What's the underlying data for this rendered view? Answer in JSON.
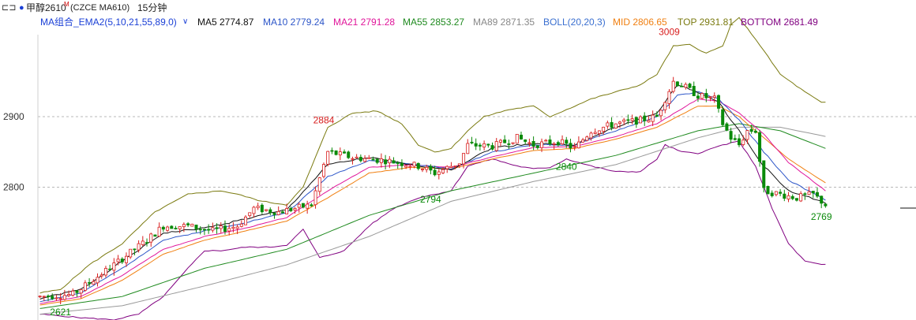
{
  "header": {
    "panel_icon": "panel-toggle-icon",
    "dot_color": "#1a3fd6",
    "instrument": "甲醇2610",
    "instrument_sup": "M",
    "symbol": "(CZCE MA610)",
    "period": "15分钟"
  },
  "indicators": {
    "group_label": "MA组合_EMA2(5,10,21,55,89,0)",
    "ma5": "MA5 2774.87",
    "ma10": "MA10 2779.24",
    "ma21": "MA21 2791.28",
    "ma55": "MA55 2853.27",
    "ma89": "MA89 2871.35",
    "boll": "BOLL(20,20,3)",
    "mid": "MID 2806.65",
    "top": "TOP 2931.81",
    "bottom": "BOTTOM 2681.49"
  },
  "colors": {
    "up": "#d81e1e",
    "down": "#0a8a0a",
    "ma5": "#111111",
    "ma10": "#2c55c8",
    "ma21": "#e0159a",
    "ma55": "#1f8a1f",
    "ma89": "#999999",
    "boll": "#3a6fd0",
    "mid": "#f07f10",
    "top": "#7a7a10",
    "bottom": "#800080"
  },
  "chart_data": {
    "type": "candlestick",
    "y_ticks": [
      "2900",
      "2800"
    ],
    "ylim": [
      2615,
      3035
    ],
    "bars": 192,
    "annotations": [
      {
        "text": "2884",
        "value": 2884,
        "bar": 69,
        "kind": "high"
      },
      {
        "text": "2794",
        "value": 2794,
        "bar": 95,
        "kind": "low"
      },
      {
        "text": "2840",
        "value": 2840,
        "bar": 128,
        "kind": "low"
      },
      {
        "text": "3009",
        "value": 3009,
        "bar": 153,
        "kind": "high"
      },
      {
        "text": "2769",
        "value": 2769,
        "bar": 190,
        "kind": "low"
      },
      {
        "text": "2621",
        "value": 2621,
        "bar": 5,
        "kind": "low"
      }
    ],
    "close_path": [
      [
        0,
        2645
      ],
      [
        8,
        2648
      ],
      [
        18,
        2690
      ],
      [
        26,
        2725
      ],
      [
        30,
        2745
      ],
      [
        36,
        2745
      ],
      [
        42,
        2738
      ],
      [
        48,
        2745
      ],
      [
        52,
        2770
      ],
      [
        58,
        2765
      ],
      [
        62,
        2770
      ],
      [
        66,
        2775
      ],
      [
        70,
        2850
      ],
      [
        76,
        2842
      ],
      [
        84,
        2838
      ],
      [
        92,
        2830
      ],
      [
        96,
        2820
      ],
      [
        102,
        2835
      ],
      [
        104,
        2860
      ],
      [
        110,
        2858
      ],
      [
        116,
        2870
      ],
      [
        120,
        2860
      ],
      [
        126,
        2865
      ],
      [
        130,
        2855
      ],
      [
        134,
        2880
      ],
      [
        140,
        2890
      ],
      [
        146,
        2895
      ],
      [
        150,
        2900
      ],
      [
        154,
        2950
      ],
      [
        156,
        2945
      ],
      [
        160,
        2930
      ],
      [
        164,
        2925
      ],
      [
        166,
        2890
      ],
      [
        168,
        2870
      ],
      [
        170,
        2860
      ],
      [
        172,
        2880
      ],
      [
        174,
        2880
      ],
      [
        176,
        2795
      ],
      [
        180,
        2790
      ],
      [
        184,
        2785
      ],
      [
        188,
        2790
      ],
      [
        191,
        2775
      ]
    ],
    "ma5_path": [
      [
        0,
        2642
      ],
      [
        10,
        2655
      ],
      [
        20,
        2695
      ],
      [
        30,
        2735
      ],
      [
        40,
        2742
      ],
      [
        50,
        2755
      ],
      [
        60,
        2768
      ],
      [
        70,
        2832
      ],
      [
        80,
        2842
      ],
      [
        90,
        2832
      ],
      [
        100,
        2825
      ],
      [
        110,
        2856
      ],
      [
        120,
        2862
      ],
      [
        130,
        2860
      ],
      [
        140,
        2885
      ],
      [
        150,
        2905
      ],
      [
        155,
        2945
      ],
      [
        160,
        2935
      ],
      [
        165,
        2920
      ],
      [
        170,
        2880
      ],
      [
        176,
        2830
      ],
      [
        182,
        2795
      ],
      [
        191,
        2778
      ]
    ],
    "ma10_path": [
      [
        0,
        2638
      ],
      [
        10,
        2650
      ],
      [
        20,
        2685
      ],
      [
        30,
        2725
      ],
      [
        40,
        2738
      ],
      [
        50,
        2750
      ],
      [
        60,
        2764
      ],
      [
        70,
        2815
      ],
      [
        80,
        2838
      ],
      [
        90,
        2833
      ],
      [
        100,
        2826
      ],
      [
        110,
        2850
      ],
      [
        120,
        2860
      ],
      [
        130,
        2860
      ],
      [
        140,
        2880
      ],
      [
        150,
        2900
      ],
      [
        155,
        2930
      ],
      [
        160,
        2935
      ],
      [
        165,
        2925
      ],
      [
        170,
        2895
      ],
      [
        176,
        2850
      ],
      [
        182,
        2810
      ],
      [
        191,
        2782
      ]
    ],
    "ma21_path": [
      [
        0,
        2635
      ],
      [
        10,
        2645
      ],
      [
        20,
        2675
      ],
      [
        30,
        2712
      ],
      [
        40,
        2730
      ],
      [
        50,
        2742
      ],
      [
        60,
        2757
      ],
      [
        70,
        2795
      ],
      [
        80,
        2828
      ],
      [
        90,
        2832
      ],
      [
        100,
        2828
      ],
      [
        110,
        2843
      ],
      [
        120,
        2856
      ],
      [
        130,
        2858
      ],
      [
        140,
        2872
      ],
      [
        150,
        2890
      ],
      [
        160,
        2925
      ],
      [
        165,
        2922
      ],
      [
        170,
        2905
      ],
      [
        176,
        2875
      ],
      [
        182,
        2835
      ],
      [
        191,
        2795
      ]
    ],
    "mid_path": [
      [
        0,
        2633
      ],
      [
        10,
        2642
      ],
      [
        20,
        2668
      ],
      [
        30,
        2705
      ],
      [
        40,
        2725
      ],
      [
        50,
        2738
      ],
      [
        60,
        2752
      ],
      [
        70,
        2785
      ],
      [
        80,
        2820
      ],
      [
        90,
        2828
      ],
      [
        100,
        2826
      ],
      [
        110,
        2840
      ],
      [
        120,
        2852
      ],
      [
        130,
        2855
      ],
      [
        140,
        2868
      ],
      [
        150,
        2885
      ],
      [
        160,
        2915
      ],
      [
        165,
        2915
      ],
      [
        170,
        2900
      ],
      [
        176,
        2870
      ],
      [
        182,
        2840
      ],
      [
        191,
        2806
      ]
    ],
    "ma55_path": [
      [
        0,
        2628
      ],
      [
        20,
        2645
      ],
      [
        40,
        2685
      ],
      [
        60,
        2712
      ],
      [
        80,
        2760
      ],
      [
        100,
        2795
      ],
      [
        120,
        2820
      ],
      [
        140,
        2845
      ],
      [
        160,
        2880
      ],
      [
        170,
        2890
      ],
      [
        180,
        2880
      ],
      [
        191,
        2855
      ]
    ],
    "ma89_path": [
      [
        0,
        2620
      ],
      [
        20,
        2632
      ],
      [
        40,
        2660
      ],
      [
        60,
        2690
      ],
      [
        80,
        2730
      ],
      [
        100,
        2780
      ],
      [
        120,
        2808
      ],
      [
        140,
        2832
      ],
      [
        160,
        2870
      ],
      [
        170,
        2885
      ],
      [
        180,
        2885
      ],
      [
        191,
        2872
      ]
    ],
    "top_path": [
      [
        0,
        2650
      ],
      [
        5,
        2655
      ],
      [
        12,
        2690
      ],
      [
        20,
        2720
      ],
      [
        28,
        2765
      ],
      [
        36,
        2790
      ],
      [
        44,
        2795
      ],
      [
        48,
        2790
      ],
      [
        54,
        2780
      ],
      [
        60,
        2775
      ],
      [
        64,
        2800
      ],
      [
        70,
        2885
      ],
      [
        76,
        2905
      ],
      [
        82,
        2908
      ],
      [
        88,
        2890
      ],
      [
        92,
        2860
      ],
      [
        96,
        2850
      ],
      [
        100,
        2855
      ],
      [
        104,
        2880
      ],
      [
        108,
        2900
      ],
      [
        114,
        2910
      ],
      [
        120,
        2915
      ],
      [
        124,
        2900
      ],
      [
        128,
        2910
      ],
      [
        134,
        2925
      ],
      [
        140,
        2935
      ],
      [
        146,
        2945
      ],
      [
        150,
        2960
      ],
      [
        154,
        3000
      ],
      [
        158,
        3002
      ],
      [
        162,
        2990
      ],
      [
        166,
        3000
      ],
      [
        168,
        3030
      ],
      [
        170,
        3040
      ],
      [
        174,
        3010
      ],
      [
        180,
        2960
      ],
      [
        186,
        2935
      ],
      [
        190,
        2920
      ]
    ],
    "bottom_path": [
      [
        0,
        2620
      ],
      [
        10,
        2615
      ],
      [
        18,
        2612
      ],
      [
        24,
        2620
      ],
      [
        30,
        2645
      ],
      [
        36,
        2685
      ],
      [
        40,
        2710
      ],
      [
        44,
        2710
      ],
      [
        50,
        2715
      ],
      [
        56,
        2715
      ],
      [
        60,
        2718
      ],
      [
        64,
        2740
      ],
      [
        68,
        2700
      ],
      [
        74,
        2710
      ],
      [
        80,
        2745
      ],
      [
        86,
        2770
      ],
      [
        92,
        2785
      ],
      [
        96,
        2790
      ],
      [
        100,
        2795
      ],
      [
        104,
        2830
      ],
      [
        110,
        2840
      ],
      [
        116,
        2830
      ],
      [
        120,
        2826
      ],
      [
        124,
        2828
      ],
      [
        128,
        2840
      ],
      [
        134,
        2830
      ],
      [
        140,
        2822
      ],
      [
        146,
        2822
      ],
      [
        150,
        2840
      ],
      [
        152,
        2860
      ],
      [
        156,
        2850
      ],
      [
        160,
        2848
      ],
      [
        166,
        2860
      ],
      [
        170,
        2865
      ],
      [
        174,
        2830
      ],
      [
        178,
        2770
      ],
      [
        182,
        2720
      ],
      [
        186,
        2695
      ],
      [
        190,
        2690
      ]
    ]
  }
}
